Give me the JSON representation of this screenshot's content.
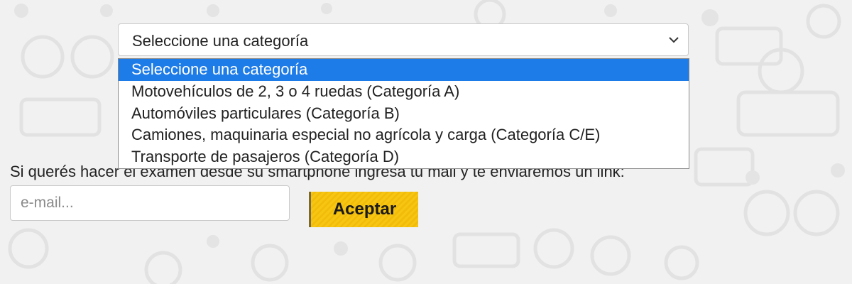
{
  "category_select": {
    "selected_value": "Seleccione una categoría",
    "options": [
      "Seleccione una categoría",
      "Motovehículos de 2, 3 o 4 ruedas (Categoría A)",
      "Automóviles particulares (Categoría B)",
      "Camiones, maquinaria especial no agrícola y carga (Categoría C/E)",
      "Transporte de pasajeros (Categoría D)"
    ],
    "highlighted_index": 0,
    "chevron_icon": "chevron-down-icon"
  },
  "email_section": {
    "prompt": "Si querés hacer el examen desde su smartphone ingresa tu mail y te enviaremos un link:",
    "email_placeholder": "e-mail...",
    "email_value": "",
    "accept_label": "Aceptar"
  },
  "colors": {
    "highlight": "#1e7ce8",
    "button": "#f7c613",
    "background": "#f1f1f1"
  },
  "background_pattern": "transport-icons-watermark"
}
